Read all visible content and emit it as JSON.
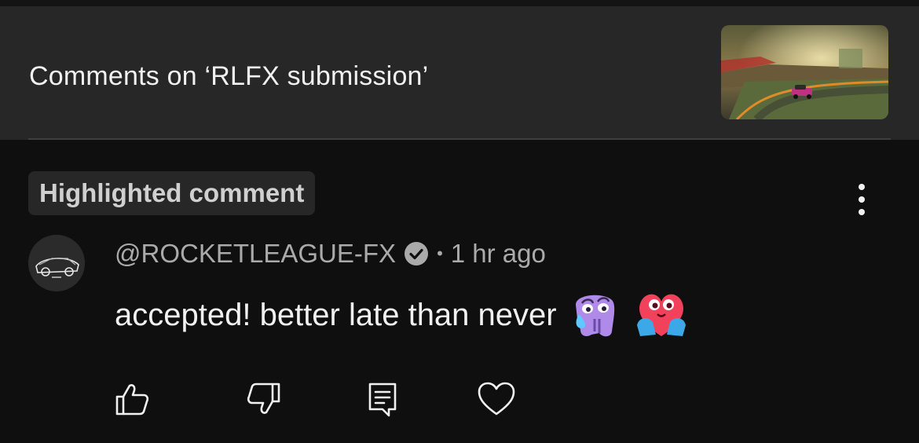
{
  "header": {
    "title": "Comments on ‘RLFX submission’",
    "thumbnail_icon": "video-thumbnail"
  },
  "comment": {
    "badge": "Highlighted comment",
    "author": "@ROCKETLEAGUE-FX",
    "separator": "•",
    "time": "1 hr ago",
    "text": "accepted! better late than never",
    "emojis": [
      "crying-face-emoji",
      "heart-hug-emoji"
    ],
    "verified": true
  },
  "actions": {
    "icons": [
      "thumbs-up-icon",
      "thumbs-down-icon",
      "reply-icon",
      "heart-icon"
    ]
  },
  "colors": {
    "background": "#0f0f0f",
    "header_bg": "#272727",
    "text": "#f1f1f1",
    "muted": "#aaaaaa"
  }
}
